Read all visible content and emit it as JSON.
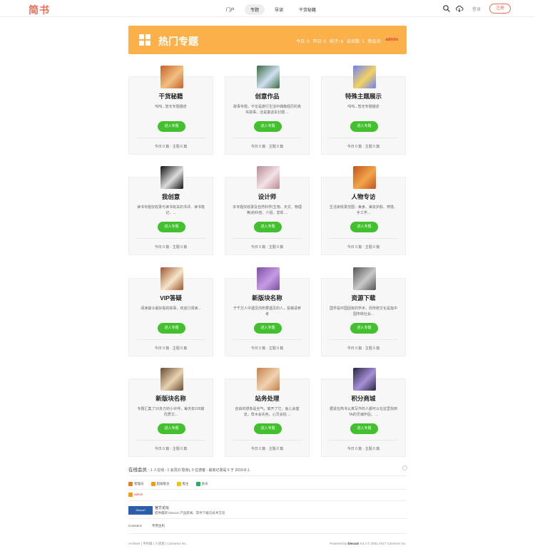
{
  "header": {
    "logo": "简书",
    "nav": [
      "门户",
      "专题",
      "导读",
      "干货秘籍"
    ],
    "login": "登录",
    "register": "注册"
  },
  "banner": {
    "title": "热门专题",
    "today": "今日: 0",
    "yesterday": "昨日: 0",
    "posts": "帖子: 6",
    "members": "会员数: 1",
    "newest_label": "新会员:",
    "newest_user": "admin"
  },
  "cards": [
    {
      "title": "干货秘籍",
      "desc": "呜呜...暂无专题描述",
      "button": "进入专题",
      "stats": "今日 0 篇 · 主题 6 篇",
      "img": [
        "#c8602b",
        "#f0c080"
      ]
    },
    {
      "title": "创意作品",
      "desc": "故事专题，不论是旅行生活中偶像经历的真实故事，还是童话玄幻题 ...",
      "button": "进入专题",
      "stats": "今日 0 篇 · 主题 0 篇",
      "img": [
        "#3a6a3f",
        "#cfe0f0"
      ]
    },
    {
      "title": "特殊主题展示",
      "desc": "呜呜...暂无专题描述",
      "button": "进入专题",
      "stats": "今日 0 篇 · 主题 0 篇",
      "img": [
        "#6a7fff",
        "#f4d35e"
      ]
    },
    {
      "title": "我创意",
      "desc": "读书专题仅收录与读书有关的书评、读书笔记、...",
      "button": "进入专题",
      "stats": "今日 0 篇 · 主题 0 篇",
      "img": [
        "#111111",
        "#dddddd"
      ]
    },
    {
      "title": "设计师",
      "desc": "本专题仅收录及自然科学(生物、天文、物理等)的科普、介绍、发现 ...",
      "button": "进入专题",
      "stats": "今日 0 篇 · 主题 0 篇",
      "img": [
        "#b98a95",
        "#f3e2e6"
      ]
    },
    {
      "title": "人物专访",
      "desc": "生活家收录范围：美食、美妆护肤、穿搭、手工学...",
      "button": "进入专题",
      "stats": "今日 0 篇 · 主题 0 篇",
      "img": [
        "#c0561f",
        "#f2a54a"
      ]
    },
    {
      "title": "VIP答疑",
      "desc": "阅读最令最好看的故事，欢迎订阅读...",
      "button": "进入专题",
      "stats": "今日 0 篇 · 主题 0 篇",
      "img": [
        "#a0522d",
        "#f5e6c8"
      ]
    },
    {
      "title": "新版块名称",
      "desc": "于千万人中遇见你所要遇见的人，投稿请参考",
      "button": "进入专题",
      "stats": "今日 0 篇 · 主题 0 篇",
      "img": [
        "#7a4fa3",
        "#c79be3"
      ]
    },
    {
      "title": "资源下载",
      "desc": "国学是中国固有的学术，而传统文化是指中国传统社会...",
      "button": "进入专题",
      "stats": "今日 0 篇 · 主题 0 篇",
      "img": [
        "#555555",
        "#c9c9c9"
      ]
    },
    {
      "title": "新版块名称",
      "desc": "专题汇集了10多万的小伙伴，每天有100篇优质文...",
      "button": "进入专题",
      "stats": "今日 0 篇 · 主题 0 篇",
      "img": [
        "#6b4b34",
        "#e8d3b0"
      ]
    },
    {
      "title": "站务处理",
      "desc": "自由的想象是全气，离开了它，鱼儿会窒息，草木会失色，心灵会枯 ...",
      "button": "进入专题",
      "stats": "今日 0 篇 · 主题 0 篇",
      "img": [
        "#c4814b",
        "#f1d2b0"
      ]
    },
    {
      "title": "积分商城",
      "desc": "据说在简书认真写作的人都可以在这里找到TA的灵魂伴侣。 ...",
      "button": "进入专题",
      "stats": "今日 0 篇 · 主题 0 篇",
      "img": [
        "#2a2540",
        "#a690d8"
      ]
    }
  ],
  "online": {
    "label": "在线会员",
    "detail": "- 1 人在线 - 1 会员(0 隐身), 0 位游客 - 最高记录是 6 于 2019-8-1."
  },
  "legend": [
    "管理员",
    "超级版主",
    "版主",
    "会员"
  ],
  "admin_user": "admin",
  "forum": {
    "logo": "Discuz!",
    "title": "官方论坛",
    "desc": "提供最新 Discuz! 产品新闻、软件下载与技术交流"
  },
  "links": [
    "Comsenz",
    "专用主机"
  ],
  "footer": {
    "left": "Archiver | 手机版 | 小黑屋 | Comsenz Inc.",
    "powered": "Powered by",
    "brand": "Discuz!",
    "version": "X3.4 © 2001-2017 Comsenz Inc."
  },
  "colors": {
    "brand": "#ea6f5a",
    "banner": "#fbb04a",
    "button": "#42c02e"
  }
}
